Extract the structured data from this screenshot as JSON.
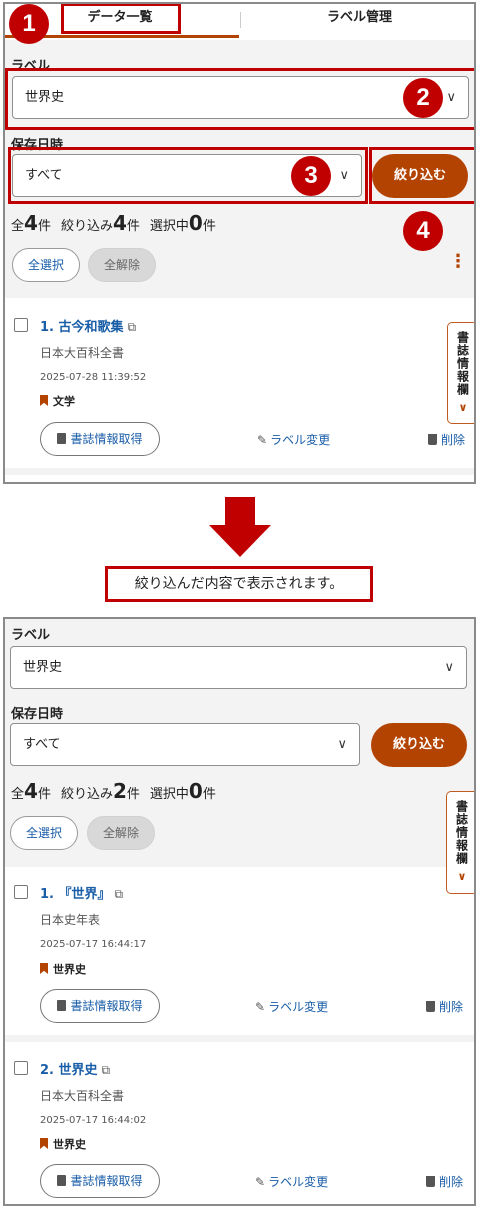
{
  "tabs": {
    "data_list": "データ一覧",
    "label_mgmt": "ラベル管理"
  },
  "filter": {
    "label_heading": "ラベル",
    "label_value": "世界史",
    "date_heading": "保存日時",
    "date_value": "すべて",
    "filter_button": "絞り込む",
    "chevron": "∨"
  },
  "top": {
    "counts": {
      "total_prefix": "全",
      "total": "4",
      "unit": "件",
      "filtered_prefix": "絞り込み",
      "filtered": "4",
      "selected_prefix": "選択中",
      "selected": "0"
    },
    "items": [
      {
        "index": "1.",
        "title": "古今和歌集",
        "source": "日本大百科全書",
        "date": "2025-07-28 11:39:52",
        "tag": "文学"
      }
    ]
  },
  "bottom": {
    "counts": {
      "total_prefix": "全",
      "total": "4",
      "unit": "件",
      "filtered_prefix": "絞り込み",
      "filtered": "2",
      "selected_prefix": "選択中",
      "selected": "0"
    },
    "items": [
      {
        "index": "1.",
        "title": "『世界』",
        "source": "日本史年表",
        "date": "2025-07-17 16:44:17",
        "tag": "世界史"
      },
      {
        "index": "2.",
        "title": "世界史",
        "source": "日本大百科全書",
        "date": "2025-07-17 16:44:02",
        "tag": "世界史"
      }
    ]
  },
  "buttons": {
    "select_all": "全選択",
    "clear_all": "全解除",
    "fetch": "書誌情報取得",
    "change_label": "ラベル変更",
    "delete": "削除"
  },
  "side_tab": "書誌情報欄",
  "side_tab_chevron": "∨",
  "external_icon": "⧉",
  "edit_icon": "✎",
  "kebab": "⋮",
  "callouts": [
    "1",
    "2",
    "3",
    "4"
  ],
  "caption": "絞り込んだ内容で表示されます。",
  "icons": [
    "external-link-icon",
    "bookmark-icon",
    "document-icon",
    "edit-icon",
    "trash-icon",
    "chevron-down-icon",
    "kebab-menu-icon",
    "arrow-down-icon"
  ],
  "colors": {
    "accent": "#b34300",
    "link": "#1a5ea8",
    "callout_red": "#c00000"
  }
}
